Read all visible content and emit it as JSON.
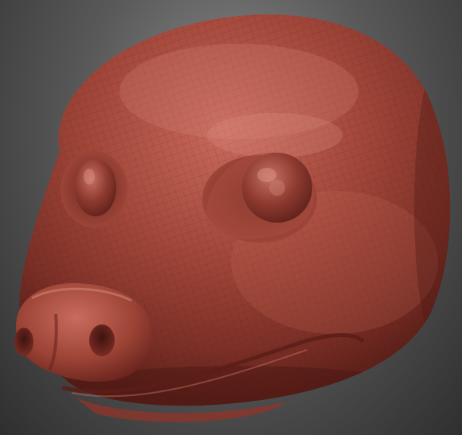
{
  "app": {
    "title": ""
  },
  "viewport": {
    "subject": "sculpted-head-model",
    "material_color": "#9a3a2e",
    "background_top": "#8a8a8a",
    "background_bottom": "#2f2f2f",
    "wireframe_visible": true
  },
  "icons": []
}
